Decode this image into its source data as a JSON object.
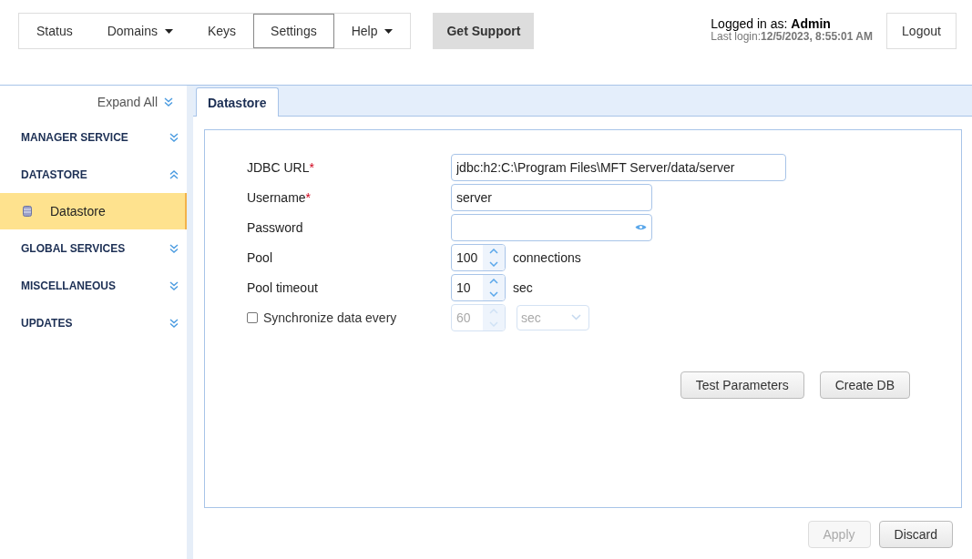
{
  "nav": {
    "items": [
      {
        "label": "Status",
        "selected": false,
        "dropdown": false
      },
      {
        "label": "Domains",
        "selected": false,
        "dropdown": true
      },
      {
        "label": "Keys",
        "selected": false,
        "dropdown": false
      },
      {
        "label": "Settings",
        "selected": true,
        "dropdown": false
      },
      {
        "label": "Help",
        "selected": false,
        "dropdown": true
      }
    ],
    "support_button": "Get Support"
  },
  "user": {
    "logged_in_label": "Logged in as:",
    "name": "Admin",
    "last_login_label": "Last login:",
    "last_login": "12/5/2023, 8:55:01 AM",
    "logout_button": "Logout"
  },
  "sidebar": {
    "expand_all": "Expand All",
    "sections": [
      {
        "label": "MANAGER SERVICE",
        "expanded": false
      },
      {
        "label": "DATASTORE",
        "expanded": true,
        "children": [
          {
            "label": "Datastore",
            "selected": true
          }
        ]
      },
      {
        "label": "GLOBAL SERVICES",
        "expanded": false
      },
      {
        "label": "MISCELLANEOUS",
        "expanded": false
      },
      {
        "label": "UPDATES",
        "expanded": false
      }
    ]
  },
  "tabs": [
    {
      "label": "Datastore",
      "selected": true
    }
  ],
  "form": {
    "fields": [
      {
        "kind": "url",
        "label": "JDBC URL",
        "required_mark": "*",
        "value": "jdbc:h2:C:\\Program Files\\MFT Server/data/server"
      },
      {
        "kind": "text",
        "label": "Username",
        "required_mark": "*",
        "value": "server"
      },
      {
        "kind": "password",
        "label": "Password"
      },
      {
        "kind": "number",
        "label": "Pool",
        "value": "100",
        "unit": "connections"
      },
      {
        "kind": "number",
        "label": "Pool timeout",
        "value": "10",
        "unit": "sec"
      },
      {
        "kind": "sync",
        "label": "Synchronize data every",
        "checked": false,
        "value": "60",
        "unit_select": "sec"
      }
    ],
    "buttons": [
      "Test Parameters",
      "Create DB"
    ]
  },
  "footer": {
    "buttons": [
      {
        "label": "Apply",
        "disabled": true
      },
      {
        "label": "Discard",
        "disabled": false
      }
    ]
  }
}
